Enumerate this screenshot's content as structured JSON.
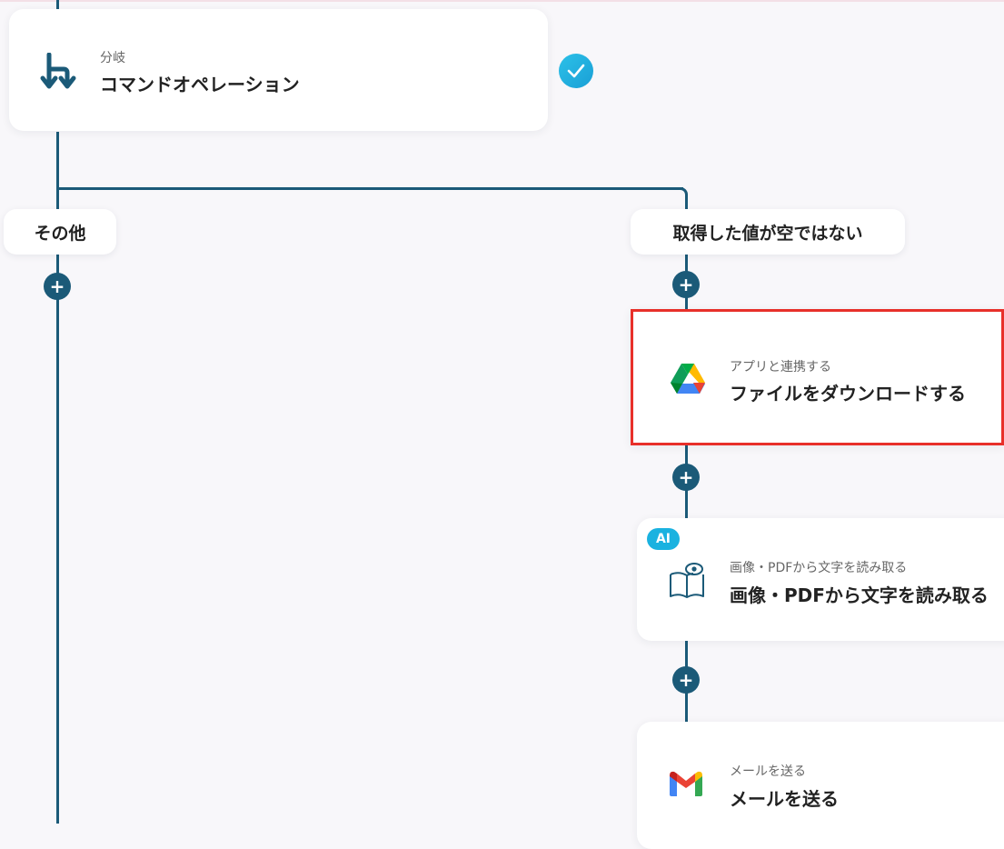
{
  "branch_card": {
    "subtitle": "分岐",
    "title": "コマンドオペレーション",
    "icon": "branch-icon",
    "status": "check-icon"
  },
  "branches": {
    "left_label": "その他",
    "right_label": "取得した値が空ではない"
  },
  "add_step": {
    "glyph": "+"
  },
  "steps": [
    {
      "subtitle": "アプリと連携する",
      "title": "ファイルをダウンロードする",
      "icon": "google-drive-icon",
      "selected": true
    },
    {
      "subtitle": "画像・PDFから文字を読み取る",
      "title": "画像・PDFから文字を読み取る",
      "icon": "ocr-book-eye-icon",
      "badge": "AI"
    },
    {
      "subtitle": "メールを送る",
      "title": "メールを送る",
      "icon": "gmail-icon"
    }
  ],
  "colors": {
    "connector": "#1b5a78",
    "selection": "#e8302a",
    "check": "#1ab2e0",
    "background": "#f8f7fa"
  }
}
